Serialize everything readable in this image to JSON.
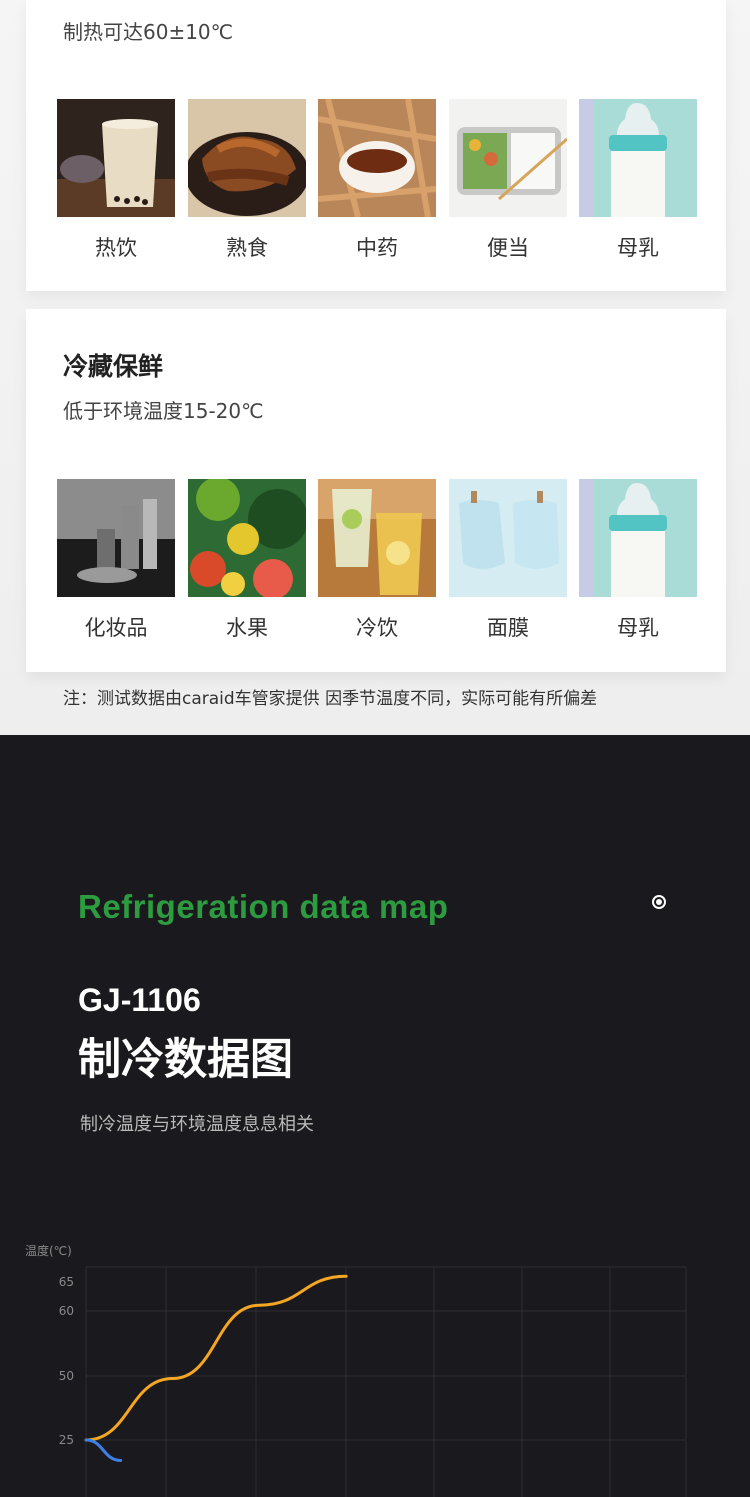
{
  "heating_card": {
    "subtitle": "制热可达60±10℃",
    "items": [
      {
        "label": "热饮",
        "icon": "milk-tea-image"
      },
      {
        "label": "熟食",
        "icon": "cooked-meat-image"
      },
      {
        "label": "中药",
        "icon": "herbal-medicine-image"
      },
      {
        "label": "便当",
        "icon": "bento-box-image"
      },
      {
        "label": "母乳",
        "icon": "baby-bottle-image"
      }
    ]
  },
  "cooling_card": {
    "title": "冷藏保鲜",
    "subtitle": "低于环境温度15-20℃",
    "items": [
      {
        "label": "化妆品",
        "icon": "cosmetics-image"
      },
      {
        "label": "水果",
        "icon": "fruit-image"
      },
      {
        "label": "冷饮",
        "icon": "cold-drink-image"
      },
      {
        "label": "面膜",
        "icon": "face-mask-image"
      },
      {
        "label": "母乳",
        "icon": "baby-bottle-image"
      }
    ]
  },
  "note": "注：测试数据由caraid车管家提供 因季节温度不同，实际可能有所偏差",
  "data_section": {
    "english_title": "Refrigeration data map",
    "model": "GJ-1106",
    "title": "制冷数据图",
    "subtitle": "制冷温度与环境温度息息相关",
    "colors": {
      "accent_green": "#2d9b3f",
      "heating_line": "#f5a623",
      "cooling_line": "#3f7fe8"
    }
  },
  "chart_data": {
    "type": "line",
    "ylabel": "温度(℃)",
    "y_ticks": [
      65,
      60,
      50,
      25
    ],
    "grid": true,
    "series": [
      {
        "x": [
          0,
          1,
          2,
          3
        ],
        "values": [
          25,
          49,
          61,
          66
        ]
      },
      {
        "x": [
          0,
          0.4
        ],
        "values": [
          25,
          17
        ]
      }
    ]
  }
}
